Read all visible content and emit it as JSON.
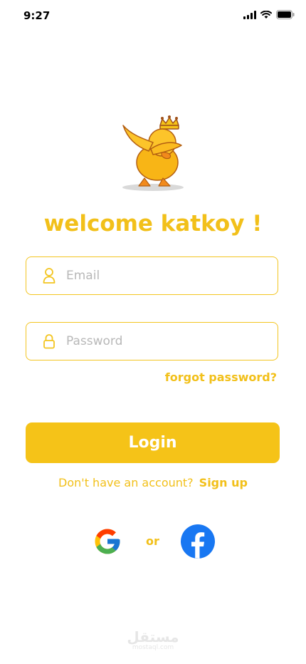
{
  "status_bar": {
    "time": "9:27"
  },
  "welcome": {
    "title": "welcome katkoy !"
  },
  "email": {
    "placeholder": "Email",
    "value": ""
  },
  "password": {
    "placeholder": "Password",
    "value": ""
  },
  "forgot": {
    "label": "forgot password?"
  },
  "login": {
    "label": "Login"
  },
  "signup": {
    "prompt": "Don't have an account?",
    "link": "Sign up"
  },
  "social": {
    "or_label": "or"
  },
  "watermark": {
    "arabic": "مستقل",
    "latin": "mostaql.com"
  },
  "colors": {
    "accent": "#f5c318",
    "border": "#f3c520",
    "facebook": "#1877f2"
  },
  "icons": [
    "user-icon",
    "lock-icon",
    "google-icon",
    "facebook-icon",
    "duck-mascot"
  ]
}
